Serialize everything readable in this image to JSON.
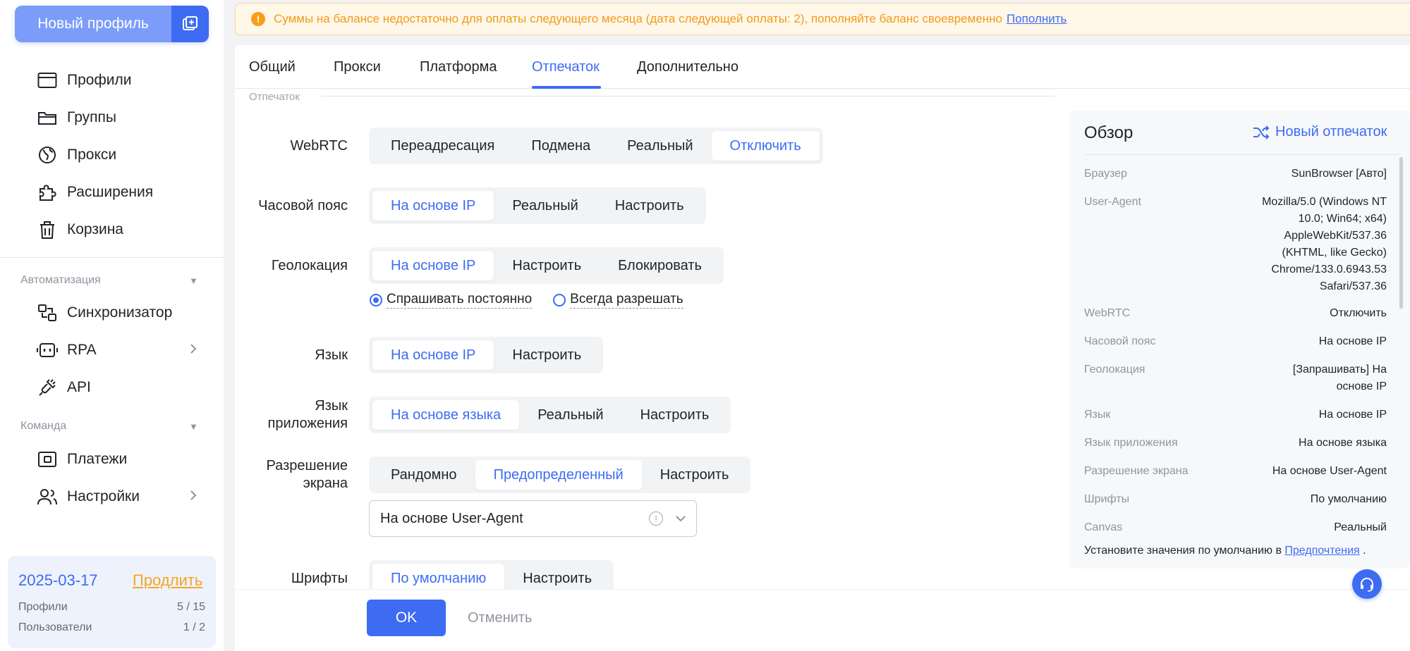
{
  "sidebar": {
    "new_profile_label": "Новый профиль",
    "items": [
      {
        "label": "Профили",
        "icon": "card-icon"
      },
      {
        "label": "Группы",
        "icon": "folder-icon"
      },
      {
        "label": "Прокси",
        "icon": "globe-icon"
      },
      {
        "label": "Расширения",
        "icon": "puzzle-icon"
      },
      {
        "label": "Корзина",
        "icon": "trash-icon"
      }
    ],
    "automation_title": "Автоматизация",
    "automation_items": [
      {
        "label": "Синхронизатор",
        "icon": "sync-icon"
      },
      {
        "label": "RPA",
        "icon": "robot-icon"
      },
      {
        "label": "API",
        "icon": "plug-icon"
      }
    ],
    "team_title": "Команда",
    "team_items": [
      {
        "label": "Платежи",
        "icon": "wallet-icon"
      },
      {
        "label": "Настройки",
        "icon": "users-icon"
      }
    ],
    "subscription": {
      "date": "2025-03-17",
      "renew": "Продлить",
      "profiles_label": "Профили",
      "profiles_value": "5 / 15",
      "users_label": "Пользователи",
      "users_value": "1 / 2"
    }
  },
  "alert": {
    "text": "Суммы на балансе недостаточно для оплаты следующего месяца (дата следующей оплаты: 2), пополняйте баланс своевременно",
    "link": "Пополнить"
  },
  "tabs": [
    "Общий",
    "Прокси",
    "Платформа",
    "Отпечаток",
    "Дополнительно"
  ],
  "active_tab": "Отпечаток",
  "section_label": "Отпечаток",
  "form": {
    "webrtc": {
      "label": "WebRTC",
      "options": [
        "Переадресация",
        "Подмена",
        "Реальный",
        "Отключить"
      ],
      "selected": 3
    },
    "timezone": {
      "label": "Часовой пояс",
      "options": [
        "На основе IP",
        "Реальный",
        "Настроить"
      ],
      "selected": 0
    },
    "geolocation": {
      "label": "Геолокация",
      "options": [
        "На основе IP",
        "Настроить",
        "Блокировать"
      ],
      "selected": 0,
      "radios": [
        "Спрашивать постоянно",
        "Всегда разрешать"
      ],
      "radio_selected": 0
    },
    "language": {
      "label": "Язык",
      "options": [
        "На основе IP",
        "Настроить"
      ],
      "selected": 0
    },
    "app_language": {
      "label_1": "Язык",
      "label_2": "приложения",
      "options": [
        "На основе языка",
        "Реальный",
        "Настроить"
      ],
      "selected": 0
    },
    "resolution": {
      "label_1": "Разрешение",
      "label_2": "экрана",
      "options": [
        "Рандомно",
        "Предопределенный",
        "Настроить"
      ],
      "selected": 1,
      "select_value": "На основе User-Agent"
    },
    "fonts": {
      "label": "Шрифты",
      "options": [
        "По умолчанию",
        "Настроить"
      ],
      "selected": 0
    }
  },
  "footer": {
    "ok": "OK",
    "cancel": "Отменить"
  },
  "overview": {
    "title": "Обзор",
    "new_fingerprint": "Новый отпечаток",
    "rows": [
      {
        "k": "Браузер",
        "v": [
          "SunBrowser [Авто]"
        ]
      },
      {
        "k": "User-Agent",
        "v": [
          "Mozilla/5.0 (Windows NT",
          "10.0; Win64; x64)",
          "AppleWebKit/537.36",
          "(KHTML, like Gecko)",
          "Chrome/133.0.6943.53",
          "Safari/537.36"
        ]
      },
      {
        "k": "WebRTC",
        "v": [
          "Отключить"
        ]
      },
      {
        "k": "Часовой пояс",
        "v": [
          "На основе IP"
        ]
      },
      {
        "k": "Геолокация",
        "v": [
          "[Запрашивать] На",
          "основе IP"
        ]
      },
      {
        "k": "Язык",
        "v": [
          "На основе IP"
        ]
      },
      {
        "k": "Язык приложения",
        "v": [
          "На основе языка"
        ]
      },
      {
        "k": "Разрешение экрана",
        "v": [
          "На основе User-Agent"
        ]
      },
      {
        "k": "Шрифты",
        "v": [
          "По умолчанию"
        ]
      },
      {
        "k": "Canvas",
        "v": [
          "Реальный"
        ]
      }
    ],
    "footer_text": "Установите значения по умолчанию в",
    "footer_link": "Предпочтения",
    "footer_end": "."
  },
  "colors": {
    "accent": "#3d6cf2",
    "warning": "#f29a1a",
    "alert_bg": "#fff7e8"
  }
}
